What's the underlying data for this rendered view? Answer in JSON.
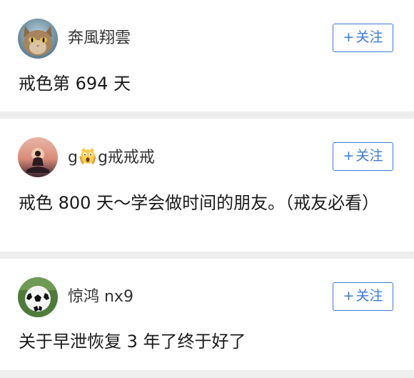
{
  "feed": {
    "posts": [
      {
        "username": "奔風翔雲",
        "follow_label": "关注",
        "follow_prefix": "+",
        "title": "戒色第 694 天",
        "avatar_icon": "cat-avatar-icon"
      },
      {
        "username_prefix": "g",
        "username_emoji": "scream-face-emoji",
        "username_suffix": "g戒戒戒",
        "follow_label": "关注",
        "follow_prefix": "+",
        "title": "戒色 800 天～学会做时间的朋友。（戒友必看）",
        "avatar_icon": "meditation-sunset-avatar-icon"
      },
      {
        "username": "惊鸿 nx9",
        "follow_label": "关注",
        "follow_prefix": "+",
        "title": "关于早泄恢复 3 年了终于好了",
        "avatar_icon": "soccer-ball-avatar-icon"
      }
    ]
  },
  "colors": {
    "accent": "#3a7bd5",
    "separator": "#eeeeee",
    "text": "#1a1a1a",
    "username": "#333333"
  }
}
